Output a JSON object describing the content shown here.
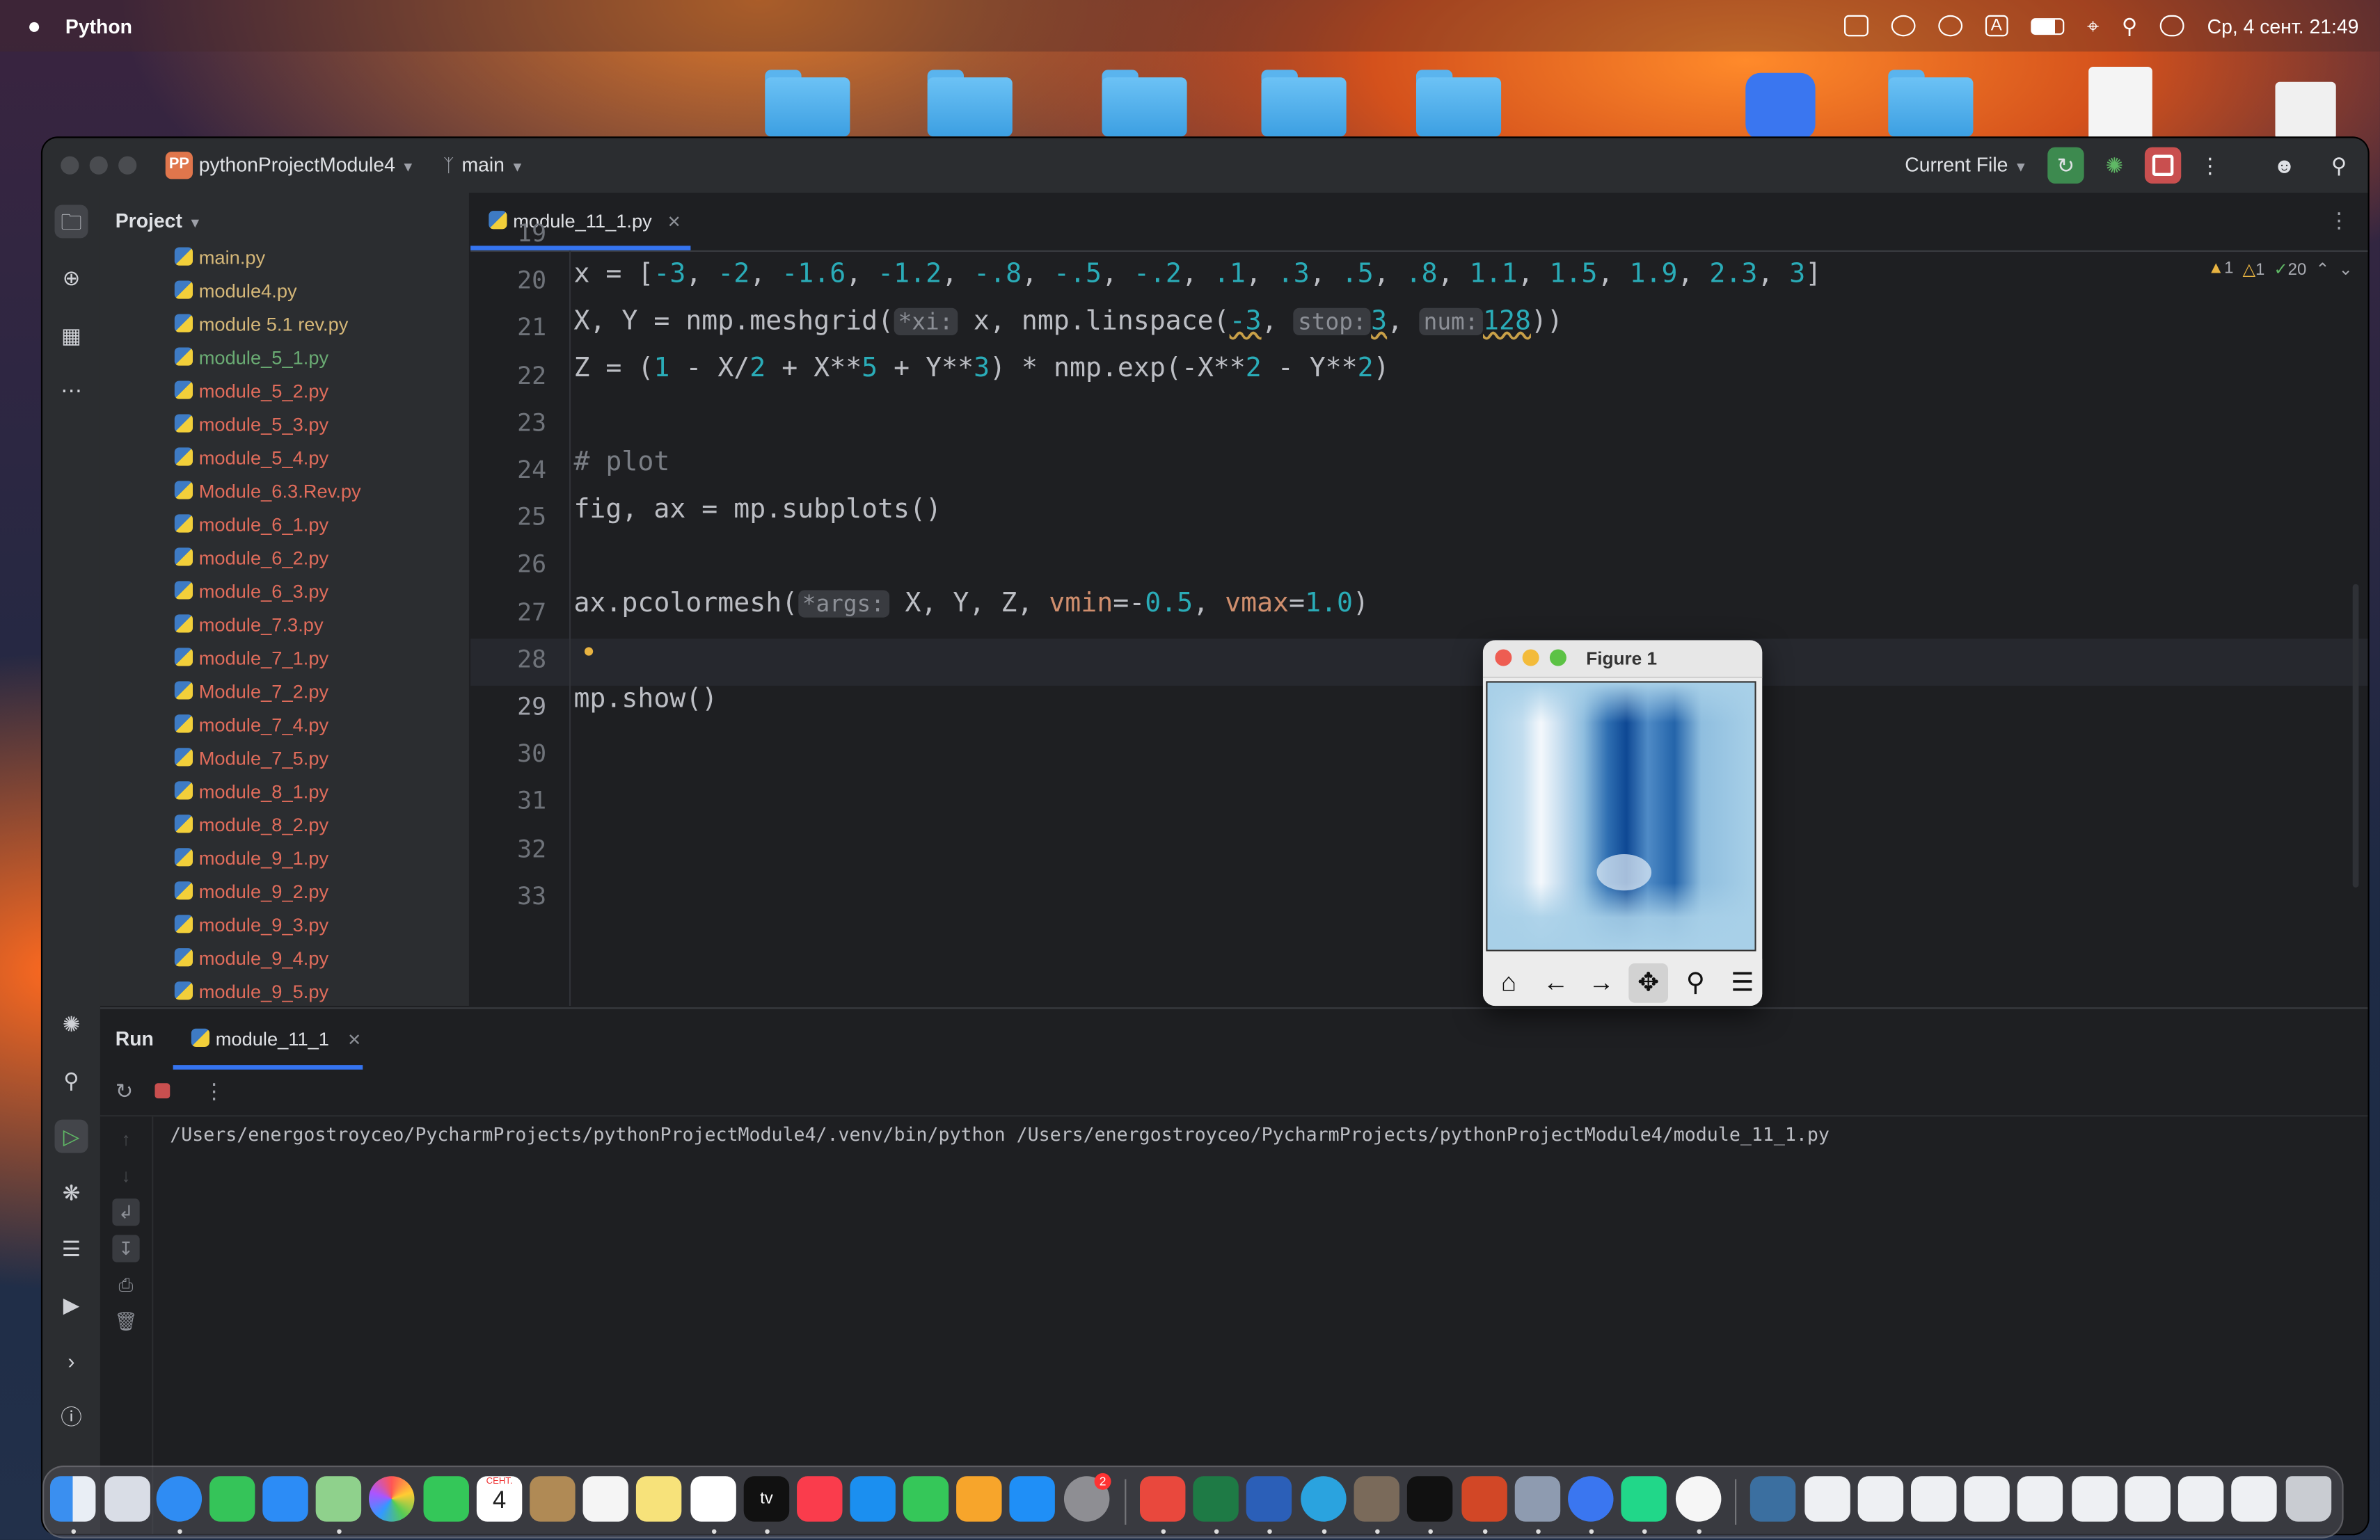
{
  "menubar": {
    "app_name": "Python",
    "datetime": "Ср, 4 сент.  21:49",
    "input_indicator": "A"
  },
  "window": {
    "project_badge": "PP",
    "project_name": "pythonProjectModule4",
    "branch": "main",
    "run_config": "Current File"
  },
  "project_panel": {
    "title": "Project",
    "files": [
      {
        "name": "main.py",
        "color": "#d5b778"
      },
      {
        "name": "module4.py",
        "color": "#d5b778"
      },
      {
        "name": "module 5.1 rev.py",
        "color": "#d5b778"
      },
      {
        "name": "module_5_1.py",
        "color": "#6aab73"
      },
      {
        "name": "module_5_2.py",
        "color": "#e06c5b"
      },
      {
        "name": "module_5_3.py",
        "color": "#e06c5b"
      },
      {
        "name": "module_5_4.py",
        "color": "#e06c5b"
      },
      {
        "name": "Module_6.3.Rev.py",
        "color": "#e06c5b"
      },
      {
        "name": "module_6_1.py",
        "color": "#e06c5b"
      },
      {
        "name": "module_6_2.py",
        "color": "#e06c5b"
      },
      {
        "name": "module_6_3.py",
        "color": "#e06c5b"
      },
      {
        "name": "module_7.3.py",
        "color": "#e06c5b"
      },
      {
        "name": "module_7_1.py",
        "color": "#e06c5b"
      },
      {
        "name": "Module_7_2.py",
        "color": "#e06c5b"
      },
      {
        "name": "module_7_4.py",
        "color": "#e06c5b"
      },
      {
        "name": "Module_7_5.py",
        "color": "#e06c5b"
      },
      {
        "name": "module_8_1.py",
        "color": "#e06c5b"
      },
      {
        "name": "module_8_2.py",
        "color": "#e06c5b"
      },
      {
        "name": "module_9_1.py",
        "color": "#e06c5b"
      },
      {
        "name": "module_9_2.py",
        "color": "#e06c5b"
      },
      {
        "name": "module_9_3.py",
        "color": "#e06c5b"
      },
      {
        "name": "module_9_4.py",
        "color": "#e06c5b"
      },
      {
        "name": "module_9_5.py",
        "color": "#e06c5b"
      }
    ]
  },
  "editor": {
    "tab_name": "module_11_1.py",
    "inspections": {
      "warnings": "1",
      "weak_warnings": "1",
      "typos": "20"
    },
    "line_numbers": [
      "19",
      "20",
      "21",
      "22",
      "23",
      "24",
      "25",
      "26",
      "27",
      "28",
      "29",
      "30",
      "31",
      "32",
      "33"
    ],
    "current_line": "29",
    "line_20": {
      "prefix": "x = [",
      "values": [
        "-3",
        "-2",
        "-1.6",
        "-1.2",
        "-.8",
        "-.5",
        "-.2",
        ".1",
        ".3",
        ".5",
        ".8",
        "1.1",
        "1.5",
        "1.9",
        "2.3",
        "3"
      ],
      "suffix": "]"
    },
    "line_21": {
      "a": "X, Y = nmp.meshgrid(",
      "hint_xi": "*xi:",
      "b": " x, nmp.linspace(",
      "v1": "-3",
      "c": ", ",
      "hint_stop": "stop:",
      "v2": "3",
      "d": ", ",
      "hint_num": "num:",
      "v3": "128",
      "e": "))"
    },
    "line_22": {
      "a": "Z = (",
      "v1": "1",
      "b": " - X/",
      "v2": "2",
      "c": " + X**",
      "v3": "5",
      "d": " + Y**",
      "v4": "3",
      "e": ") * nmp.exp(-X**",
      "v5": "2",
      "f": " - Y**",
      "v6": "2",
      "g": ")"
    },
    "line_24": "# plot",
    "line_25": "fig, ax = mp.subplots()",
    "line_27": {
      "a": "ax.pcolormesh(",
      "hint_args": "*args:",
      "b": " X, Y, Z, ",
      "k1": "vmin",
      "eq1": "=-",
      "v1": "0.5",
      "c": ", ",
      "k2": "vmax",
      "eq2": "=",
      "v2": "1.0",
      "d": ")"
    },
    "line_29": "mp.show()"
  },
  "run_panel": {
    "title": "Run",
    "tab_name": "module_11_1",
    "command": "/Users/energostroyceo/PycharmProjects/pythonProjectModule4/.venv/bin/python /Users/energostroyceo/PycharmProjects/pythonProjectModule4/module_11_1.py"
  },
  "figure": {
    "title": "Figure 1",
    "tools": [
      "home-icon",
      "back-arrow-icon",
      "forward-arrow-icon",
      "pan-icon",
      "zoom-icon",
      "configure-subplots-icon"
    ]
  },
  "dock": {
    "calendar_month": "СЕНТ.",
    "calendar_day": "4",
    "settings_badge": "2"
  },
  "colors": {
    "accent": "#3574f0",
    "run_green": "#5fb865",
    "stop_red": "#c94f4f"
  }
}
